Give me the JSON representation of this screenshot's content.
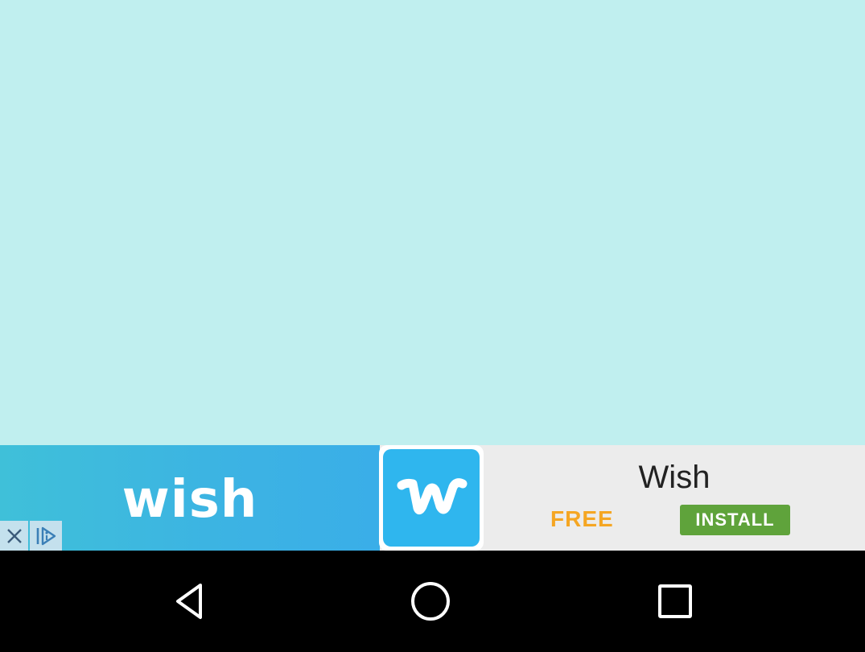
{
  "ad": {
    "wordmark": "wish",
    "title": "Wish",
    "price_label": "FREE",
    "install_label": "INSTALL",
    "colors": {
      "brand_blue": "#2fb6ee",
      "install_green": "#5fa33b",
      "price_orange": "#f5a623"
    },
    "icons": {
      "close": "close-icon",
      "ad_info": "ad-choices-icon",
      "app": "wish-app-icon"
    }
  },
  "app": {
    "background_color": "#c0efef"
  },
  "nav_bar": {
    "icons": [
      "back-icon",
      "home-icon",
      "recents-icon"
    ]
  }
}
